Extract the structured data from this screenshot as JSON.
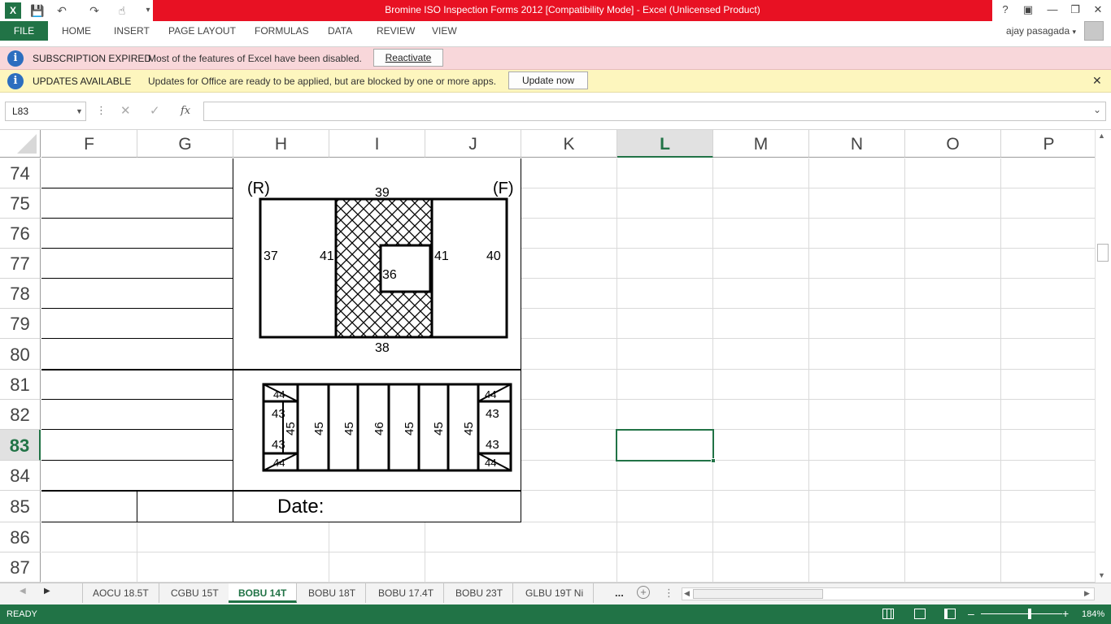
{
  "window": {
    "title": "Bromine ISO Inspection Forms 2012  [Compatibility Mode] -  Excel (Unlicensed Product)",
    "help": "?",
    "user_name": "ajay pasagada"
  },
  "ribbon": {
    "file_label": "FILE",
    "tabs": [
      "HOME",
      "INSERT",
      "PAGE LAYOUT",
      "FORMULAS",
      "DATA",
      "REVIEW",
      "VIEW"
    ]
  },
  "messages": {
    "subscription": {
      "title": "SUBSCRIPTION EXPIRED",
      "text": "Most of the features of Excel have been disabled.",
      "button": "Reactivate"
    },
    "updates": {
      "title": "UPDATES AVAILABLE",
      "text": "Updates for Office are ready to be applied, but are blocked by one or more apps.",
      "button": "Update now"
    }
  },
  "formula_bar": {
    "name_box": "L83",
    "fx": "fx",
    "value": ""
  },
  "grid": {
    "columns": [
      "F",
      "G",
      "H",
      "I",
      "J",
      "K",
      "L",
      "M",
      "N",
      "O",
      "P"
    ],
    "selected_column": "L",
    "rows": [
      "74",
      "75",
      "76",
      "77",
      "78",
      "79",
      "80",
      "81",
      "82",
      "83",
      "84",
      "85",
      "86",
      "87"
    ],
    "selected_row": "83",
    "date_label": "Date:"
  },
  "diagram_top": {
    "corner_left": "(R)",
    "corner_right": "(F)",
    "top": "39",
    "bottom": "38",
    "left_outer": "37",
    "left_inner": "41",
    "right_inner": "41",
    "right_outer": "40",
    "center": "36"
  },
  "diagram_bottom": {
    "corner_top_left": "44",
    "corner_bottom_left": "44",
    "corner_top_right": "44",
    "corner_bottom_right": "44",
    "left_top": "43",
    "left_bottom": "43",
    "right_top": "43",
    "right_bottom": "43",
    "left_vertical": "45",
    "slats": [
      "45",
      "45",
      "46",
      "45",
      "45",
      "45"
    ]
  },
  "sheet_tabs": [
    "AOCU 18.5T",
    "CGBU 15T",
    "BOBU 14T",
    "BOBU 18T",
    "BOBU 17.4T",
    "BOBU 23T",
    "GLBU 19T Ni"
  ],
  "active_sheet": "BOBU 14T",
  "more_tabs": "...",
  "status": {
    "mode": "READY",
    "zoom": "184%"
  }
}
